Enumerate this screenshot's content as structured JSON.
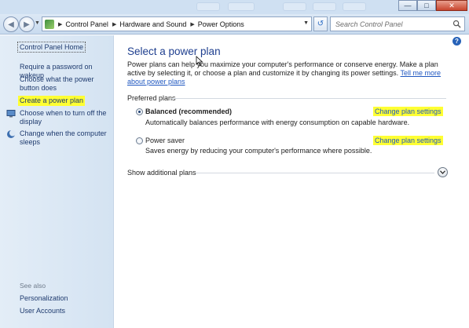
{
  "address_bar": {
    "breadcrumbs": [
      "Control Panel",
      "Hardware and Sound",
      "Power Options"
    ]
  },
  "search": {
    "placeholder": "Search Control Panel"
  },
  "sidebar": {
    "home": "Control Panel Home",
    "links": [
      "Require a password on wakeup",
      "Choose what the power button does",
      "Create a power plan",
      "Choose when to turn off the display",
      "Change when the computer sleeps"
    ],
    "see_also_label": "See also",
    "see_also": [
      "Personalization",
      "User Accounts"
    ]
  },
  "main": {
    "title": "Select a power plan",
    "intro": "Power plans can help you maximize your computer's performance or conserve energy. Make a plan active by selecting it, or choose a plan and customize it by changing its power settings.",
    "intro_link": "Tell me more about power plans",
    "group_title": "Preferred plans",
    "plans": [
      {
        "name": "Balanced (recommended)",
        "description": "Automatically balances performance with energy consumption on capable hardware.",
        "change_link": "Change plan settings",
        "selected": true
      },
      {
        "name": "Power saver",
        "description": "Saves energy by reducing your computer's performance where possible.",
        "change_link": "Change plan settings",
        "selected": false
      }
    ],
    "show_additional": "Show additional plans"
  },
  "colors": {
    "highlight": "#ffff33",
    "link": "#1f57c0",
    "heading": "#1f3f8f",
    "sidebar_bg": "#dde9f5"
  }
}
